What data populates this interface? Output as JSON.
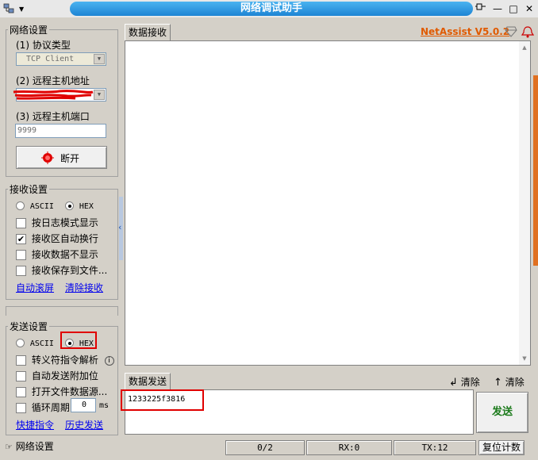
{
  "window": {
    "title": "网络调试助手",
    "brand": "NetAssist V5.0.2",
    "colors": {
      "title_bar": "#1d84d4",
      "brand": "#e05a00",
      "send_button_text": "#1b7a1b",
      "highlight": "#e00000"
    }
  },
  "network": {
    "legend": "网络设置",
    "protocol_label": "(1) 协议类型",
    "protocol_value": "TCP Client",
    "host_label": "(2) 远程主机地址",
    "host_value": "",
    "port_label": "(3) 远程主机端口",
    "port_value": "9999",
    "disconnect_label": "断开"
  },
  "receive": {
    "legend": "接收设置",
    "ascii_label": "ASCII",
    "hex_label": "HEX",
    "selected": "HEX",
    "options": [
      {
        "label": "按日志模式显示",
        "checked": false
      },
      {
        "label": "接收区自动换行",
        "checked": true
      },
      {
        "label": "接收数据不显示",
        "checked": false
      },
      {
        "label": "接收保存到文件...",
        "checked": false
      }
    ],
    "auto_scroll": "自动滚屏",
    "clear_receive": "清除接收"
  },
  "send": {
    "legend": "发送设置",
    "ascii_label": "ASCII",
    "hex_label": "HEX",
    "selected": "HEX",
    "options": [
      {
        "label": "转义符指令解析",
        "checked": false
      },
      {
        "label": "自动发送附加位",
        "checked": false
      },
      {
        "label": "打开文件数据源...",
        "checked": false
      }
    ],
    "cycle_label": "循环周期",
    "cycle_value": "0",
    "cycle_unit": "ms",
    "quick_cmd": "快捷指令",
    "history": "历史发送"
  },
  "receive_area": {
    "tab": "数据接收"
  },
  "send_area": {
    "tab": "数据发送",
    "clear1": "清除",
    "clear2": "清除",
    "input_value": "1233225f3816",
    "send_button": "发送"
  },
  "statusbar": {
    "left": "网络设置",
    "counter": "0/2",
    "rx": "RX:0",
    "tx": "TX:12",
    "reset": "复位计数"
  }
}
